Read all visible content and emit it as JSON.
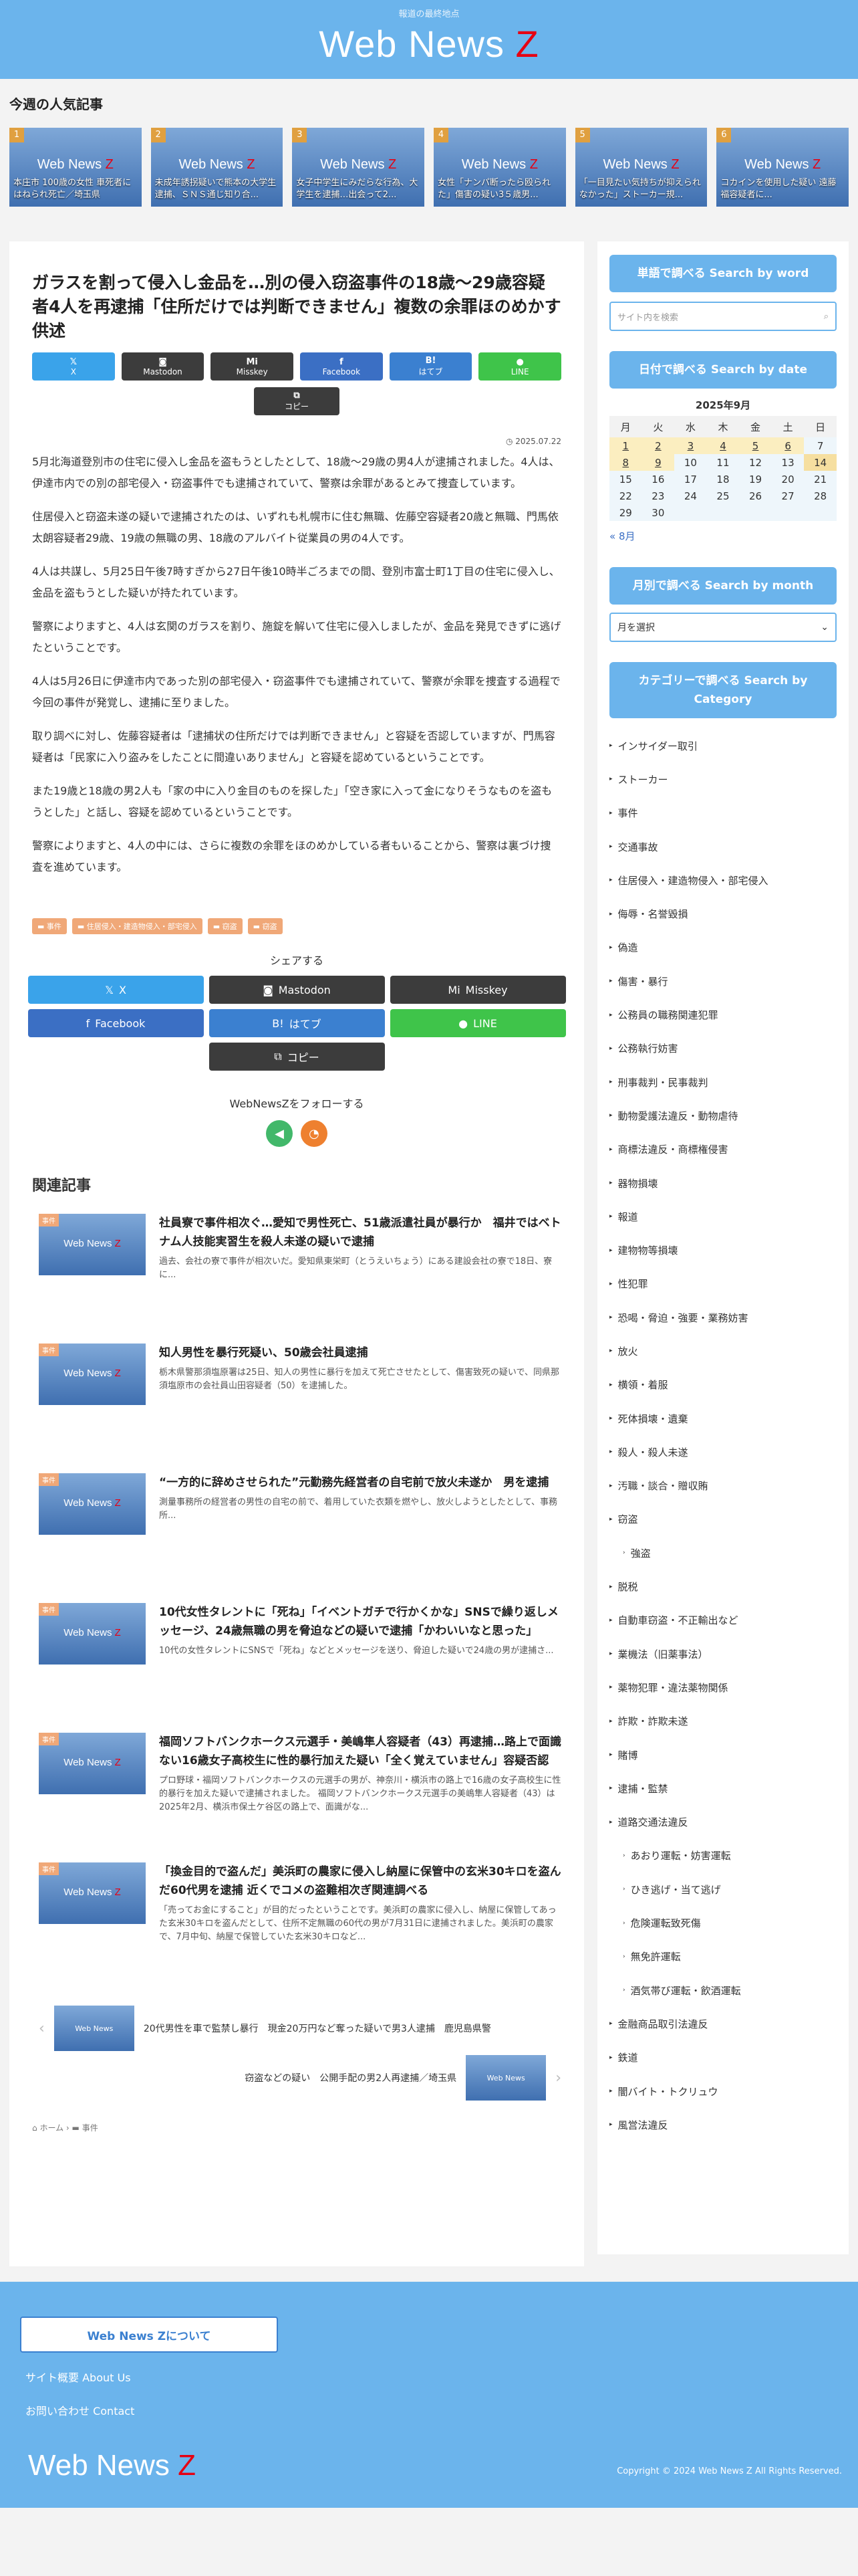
{
  "header": {
    "tagline": "報道の最終地点",
    "logo_main": "Web News",
    "logo_z": "Z"
  },
  "popular": {
    "title": "今週の人気記事",
    "thumb_logo": "Web News",
    "thumb_z": "Z",
    "items": [
      {
        "rank": "1",
        "caption": "本庄市 100歳の女性 車死者にはねられ死亡／埼玉県"
      },
      {
        "rank": "2",
        "caption": "未成年誘拐疑いで熊本の大学生逮捕、ＳＮＳ通じ知り合..."
      },
      {
        "rank": "3",
        "caption": "女子中学生にみだらな行為、大学生を逮捕…出会って2..."
      },
      {
        "rank": "4",
        "caption": "女性「ナンパ断ったら殴られた」傷害の疑い3５歳男..."
      },
      {
        "rank": "5",
        "caption": "「一目見たい気持ちが抑えられなかった」ストーカー規..."
      },
      {
        "rank": "6",
        "caption": "コカインを使用した疑い 遠藤福容疑者に..."
      }
    ]
  },
  "article": {
    "title": "ガラスを割って侵入し金品を…別の侵入窃盗事件の18歳〜29歳容疑者4人を再逮捕「住所だけでは判断できません」複数の余罪ほのめかす供述",
    "share": {
      "x": "X",
      "mastodon": "Mastodon",
      "misskey": "Misskey",
      "facebook": "Facebook",
      "hatena": "はてブ",
      "line": "LINE",
      "copy": "コピー"
    },
    "date": "2025.07.22",
    "paragraphs": [
      "5月北海道登別市の住宅に侵入し金品を盗もうとしたとして、18歳〜29歳の男4人が逮捕されました。4人は、伊達市内での別の部宅侵入・窃盗事件でも逮捕されていて、警察は余罪があるとみて捜査しています。",
      "住居侵入と窃盗未遂の疑いで逮捕されたのは、いずれも札幌市に住む無職、佐藤空容疑者20歳と無職、門馬依太朗容疑者29歳、19歳の無職の男、18歳のアルバイト従業員の男の4人です。",
      "4人は共謀し、5月25日午後7時すぎから27日午後10時半ごろまでの間、登別市富士町1丁目の住宅に侵入し、金品を盗もうとした疑いが持たれています。",
      "警察によりますと、4人は玄関のガラスを割り、施錠を解いて住宅に侵入しましたが、金品を発見できずに逃げたということです。",
      "4人は5月26日に伊達市内であった別の部宅侵入・窃盗事件でも逮捕されていて、警察が余罪を捜査する過程で今回の事件が発覚し、逮捕に至りました。",
      "取り調べに対し、佐藤容疑者は「逮捕状の住所だけでは判断できません」と容疑を否認していますが、門馬容疑者は「民家に入り盗みをしたことに間違いありません」と容疑を認めているということです。",
      "また19歳と18歳の男2人も「家の中に入り金目のものを探した」「空き家に入って金になりそうなものを盗もうとした」と話し、容疑を認めているということです。",
      "警察によりますと、4人の中には、さらに複数の余罪をほのめかしている者もいることから、警察は裏づけ捜査を進めています。"
    ],
    "tags": [
      "事件",
      "住居侵入・建造物侵入・部宅侵入",
      "窃盗",
      "窃盗"
    ],
    "share_heading": "シェアする",
    "follow_heading": "WebNewsZをフォローする",
    "related_heading": "関連記事",
    "related_badge": "事件",
    "related": [
      {
        "title": "社員寮で事件相次ぐ…愛知で男性死亡、51歳派遣社員が暴行か　福井ではベトナム人技能実習生を殺人未遂の疑いで逮捕",
        "excerpt": "過去、会社の寮で事件が相次いだ。愛知県東栄町（とうえいちょう）にある建設会社の寮で18日、寮に..."
      },
      {
        "title": "知人男性を暴行死疑い、50歳会社員逮捕",
        "excerpt": "栃木県警那須塩原署は25日、知人の男性に暴行を加えて死亡させたとして、傷害致死の疑いで、同県那須塩原市の会社員山田容疑者（50）を逮捕した。"
      },
      {
        "title": "“一方的に辞めさせられた”元勤務先経営者の自宅前で放火未遂か　男を逮捕",
        "excerpt": "測量事務所の経営者の男性の自宅の前で、着用していた衣類を燃やし、放火しようとしたとして、事務所..."
      },
      {
        "title": "10代女性タレントに「死ね」「イベントガチで行かくかな」SNSで繰り返しメッセージ、24歳無職の男を脅迫などの疑いで逮捕「かわいいなと思った」",
        "excerpt": "10代の女性タレントにSNSで「死ね」などとメッセージを送り、脅迫した疑いで24歳の男が逮捕さ..."
      },
      {
        "title": "福岡ソフトバンクホークス元選手・美嶋隼人容疑者（43）再逮捕…路上で面識ない16歳女子高校生に性的暴行加えた疑い「全く覚えていません」容疑否認",
        "excerpt": "プロ野球・福岡ソフトバンクホークスの元選手の男が、神奈川・横浜市の路上で16歳の女子高校生に性的暴行を加えた疑いで逮捕されました。 福岡ソフトバンクホークス元選手の美嶋隼人容疑者（43）は2025年2月、横浜市保土ケ谷区の路上で、面識がな..."
      },
      {
        "title": "「換金目的で盗んだ」美浜町の農家に侵入し納屋に保管中の玄米30キロを盗んだ60代男を逮捕 近くでコメの盗難相次ぎ関連調べる",
        "excerpt": "「売ってお金にすること」が目的だったということです。美浜町の農家に侵入し、納屋に保管してあった玄米30キロを盗んだとして、住所不定無職の60代の男が7月31日に逮捕されました。美浜町の農家で、7月中旬、納屋で保管していた玄米30キロなど..."
      }
    ],
    "prev_post": "20代男性を車で監禁し暴行　現金20万円など奪った疑いで男3人逮捕　鹿児島県警",
    "next_post": "窃盗などの疑い　公開手配の男2人再逮捕／埼玉県",
    "breadcrumb": {
      "home": "ホーム",
      "category": "事件"
    }
  },
  "sidebar": {
    "search_heading": "単語で調べる Search by word",
    "search_placeholder": "サイト内を検索",
    "date_heading": "日付で調べる Search by date",
    "calendar": {
      "caption": "2025年9月",
      "weekdays": [
        "月",
        "火",
        "水",
        "木",
        "金",
        "土",
        "日"
      ],
      "rows": [
        [
          "1",
          "2",
          "3",
          "4",
          "5",
          "6",
          "7"
        ],
        [
          "8",
          "9",
          "10",
          "11",
          "12",
          "13",
          "14"
        ],
        [
          "15",
          "16",
          "17",
          "18",
          "19",
          "20",
          "21"
        ],
        [
          "22",
          "23",
          "24",
          "25",
          "26",
          "27",
          "28"
        ],
        [
          "29",
          "30",
          "",
          "",
          "",
          "",
          ""
        ]
      ]
    },
    "prev_month": "« 8月",
    "month_heading": "月別で調べる Search by month",
    "month_select": "月を選択",
    "category_heading": "カテゴリーで調べる Search by Category",
    "categories": [
      {
        "label": "インサイダー取引",
        "sub": false
      },
      {
        "label": "ストーカー",
        "sub": false
      },
      {
        "label": "事件",
        "sub": false
      },
      {
        "label": "交通事故",
        "sub": false
      },
      {
        "label": "住居侵入・建造物侵入・部宅侵入",
        "sub": false
      },
      {
        "label": "侮辱・名誉毀損",
        "sub": false
      },
      {
        "label": "偽造",
        "sub": false
      },
      {
        "label": "傷害・暴行",
        "sub": false
      },
      {
        "label": "公務員の職務関連犯罪",
        "sub": false
      },
      {
        "label": "公務執行妨害",
        "sub": false
      },
      {
        "label": "刑事裁判・民事裁判",
        "sub": false
      },
      {
        "label": "動物愛護法違反・動物虐待",
        "sub": false
      },
      {
        "label": "商標法違反・商標権侵害",
        "sub": false
      },
      {
        "label": "器物損壊",
        "sub": false
      },
      {
        "label": "報道",
        "sub": false
      },
      {
        "label": "建物物等損壊",
        "sub": false
      },
      {
        "label": "性犯罪",
        "sub": false
      },
      {
        "label": "恐喝・脅迫・強要・業務妨害",
        "sub": false
      },
      {
        "label": "放火",
        "sub": false
      },
      {
        "label": "横領・着服",
        "sub": false
      },
      {
        "label": "死体損壊・遺棄",
        "sub": false
      },
      {
        "label": "殺人・殺人未遂",
        "sub": false
      },
      {
        "label": "汚職・談合・贈収賄",
        "sub": false
      },
      {
        "label": "窃盗",
        "sub": false
      },
      {
        "label": "強盗",
        "sub": true
      },
      {
        "label": "脱税",
        "sub": false
      },
      {
        "label": "自動車窃盗・不正輸出など",
        "sub": false
      },
      {
        "label": "業機法（旧薬事法）",
        "sub": false
      },
      {
        "label": "薬物犯罪・違法薬物関係",
        "sub": false
      },
      {
        "label": "詐欺・詐欺未遂",
        "sub": false
      },
      {
        "label": "賭博",
        "sub": false
      },
      {
        "label": "逮捕・監禁",
        "sub": false
      },
      {
        "label": "道路交通法違反",
        "sub": false
      },
      {
        "label": "あおり運転・妨害運転",
        "sub": true
      },
      {
        "label": "ひき逃げ・当て逃げ",
        "sub": true
      },
      {
        "label": "危険運転致死傷",
        "sub": true
      },
      {
        "label": "無免許運転",
        "sub": true
      },
      {
        "label": "酒気帯び運転・飲酒運転",
        "sub": true
      },
      {
        "label": "金融商品取引法違反",
        "sub": false
      },
      {
        "label": "鉄道",
        "sub": false
      },
      {
        "label": "闇バイト・トクリュウ",
        "sub": false
      },
      {
        "label": "風営法違反",
        "sub": false
      }
    ]
  },
  "footer": {
    "about": "Web News Zについて",
    "links": [
      "サイト概要 About Us",
      "お問い合わせ Contact"
    ],
    "logo_main": "Web News",
    "logo_z": "Z",
    "copyright": "Copyright © 2024 Web News Z All Rights Reserved."
  }
}
